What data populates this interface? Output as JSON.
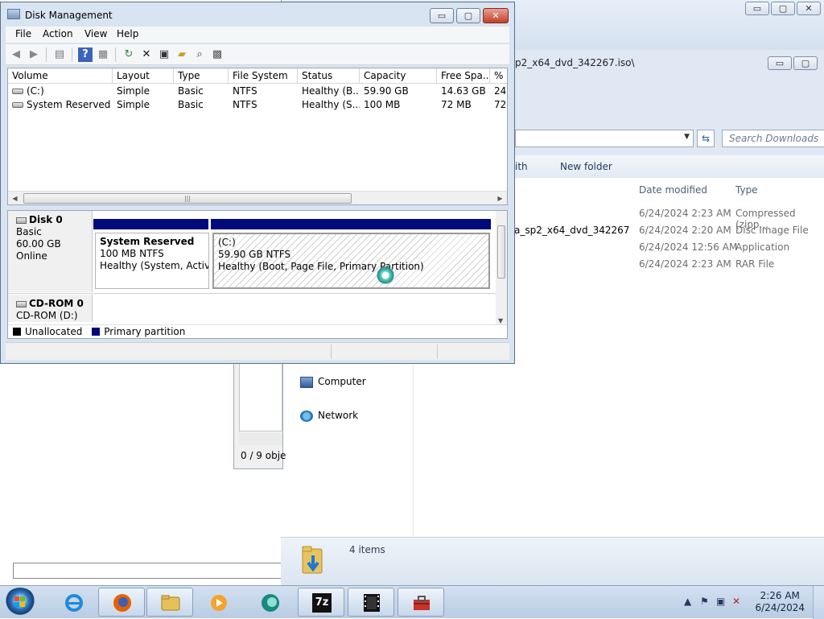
{
  "disk_management": {
    "title": "Disk Management",
    "window_buttons": {
      "minimize": "▭",
      "maximize": "▢",
      "close": "✕"
    },
    "menu": [
      "File",
      "Action",
      "View",
      "Help"
    ],
    "columns": [
      "Volume",
      "Layout",
      "Type",
      "File System",
      "Status",
      "Capacity",
      "Free Spa...",
      "% F"
    ],
    "volumes": [
      [
        "(C:)",
        "Simple",
        "Basic",
        "NTFS",
        "Healthy (B...",
        "59.90 GB",
        "14.63 GB",
        "24"
      ],
      [
        "System Reserved",
        "Simple",
        "Basic",
        "NTFS",
        "Healthy (S...",
        "100 MB",
        "72 MB",
        "72"
      ]
    ],
    "disk0": {
      "name": "Disk 0",
      "kind": "Basic",
      "size": "60.00 GB",
      "state": "Online"
    },
    "partitions": {
      "sysres": {
        "name": "System Reserved",
        "size": "100 MB NTFS",
        "status": "Healthy (System, Active,"
      },
      "c": {
        "name": "(C:)",
        "size": "59.90 GB NTFS",
        "status": "Healthy (Boot, Page File, Primary Partition)"
      }
    },
    "cdrom": {
      "name": "CD-ROM 0",
      "label": "CD-ROM (D:)"
    },
    "legend": {
      "unallocated": "Unallocated",
      "primary": "Primary partition"
    },
    "colors": {
      "unallocated": "#000000",
      "primary": "#000a7a"
    }
  },
  "explorer": {
    "address_tail": "p2_x64_dvd_342267.iso\\",
    "search_placeholder": "Search Downloads",
    "command_bar": {
      "partial_with": "ith",
      "new_folder": "New folder"
    },
    "columns": {
      "date": "Date modified",
      "type": "Type"
    },
    "files": [
      {
        "name": "",
        "date": "6/24/2024 2:23 AM",
        "type": "Compressed (zipp..."
      },
      {
        "name": "a_sp2_x64_dvd_342267",
        "date": "6/24/2024 2:20 AM",
        "type": "Disc Image File"
      },
      {
        "name": "",
        "date": "6/24/2024 12:56 AM",
        "type": "Application"
      },
      {
        "name": "",
        "date": "6/24/2024 2:23 AM",
        "type": "RAR File"
      }
    ],
    "nav": {
      "computer": "Computer",
      "network": "Network"
    },
    "item_count": "4 items",
    "behind_status": "0 / 9 obje"
  },
  "taskbar": {
    "apps": [
      "Internet Explorer",
      "Firefox",
      "Windows Explorer",
      "Media Player",
      "Spinner App",
      "7z",
      "Film",
      "Toolbox"
    ],
    "seven_zip_label": "7z",
    "clock": {
      "time": "2:26 AM",
      "date": "6/24/2024"
    }
  }
}
